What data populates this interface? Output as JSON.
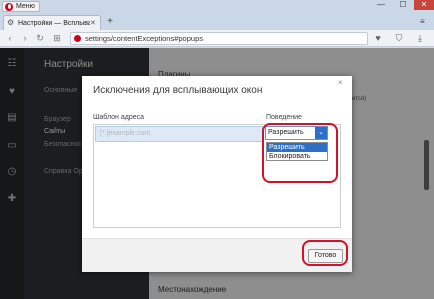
{
  "window": {
    "menu_label": "Меню",
    "minimize": "—",
    "maximize": "☐",
    "close": "✕"
  },
  "tabs": [
    {
      "title": "Настройки — Всплываю",
      "close": "✕"
    }
  ],
  "tabstrip": {
    "new_tab": "+",
    "tab_menu": "≡"
  },
  "toolbar": {
    "url": "settings/contentExceptions#popups",
    "back": "‹",
    "forward": "›",
    "reload": "↻",
    "grid": "⊞"
  },
  "settings": {
    "heading": "Настройки",
    "nav_items": [
      "Основные",
      "Браузер",
      "Сайты",
      "Безопасность",
      "Справка Opera"
    ],
    "active_item": "Сайты",
    "section_plugins": "Плагины",
    "section_geo": "Местонахождение",
    "behind_fragment": "ется)"
  },
  "dialog": {
    "title": "Исключения для всплывающих окон",
    "close": "×",
    "col_pattern": "Шаблон адреса",
    "col_behavior": "Поведение",
    "pattern_placeholder": "[*.]example.com",
    "select_value": "Разрешить",
    "options": [
      "Разрешить",
      "Блокировать"
    ],
    "selected_option": "Разрешить",
    "done_button": "Готово"
  },
  "icons": {
    "tab_icon": "gear-icon",
    "sidebar": [
      "speed-dial-icon",
      "heart-icon",
      "news-icon",
      "tabs-icon",
      "history-icon",
      "extensions-icon"
    ],
    "toolbar": [
      "heart-icon",
      "shield-icon",
      "download-icon"
    ]
  },
  "colors": {
    "annotation": "#d0132b",
    "accent": "#2b6fc9",
    "opera": "#d1001f"
  }
}
